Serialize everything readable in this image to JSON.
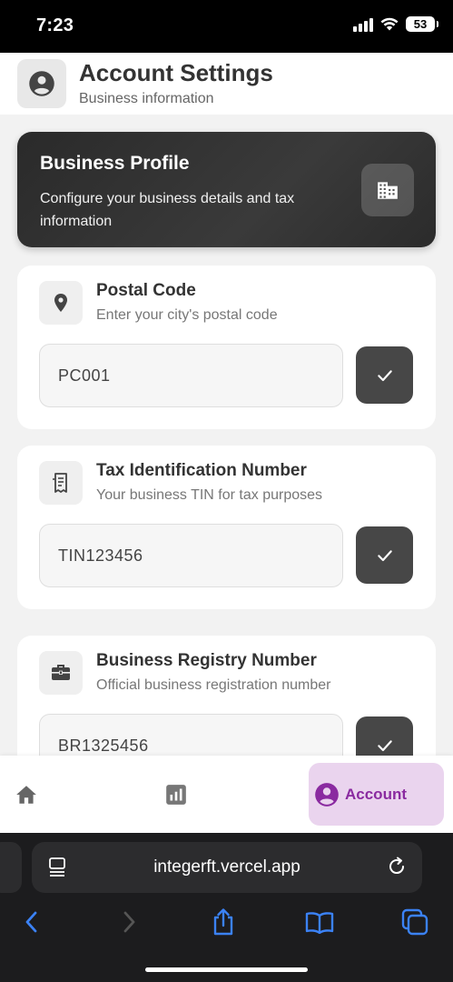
{
  "status_bar": {
    "time": "7:23",
    "battery": "53"
  },
  "header": {
    "title": "Account Settings",
    "subtitle": "Business information",
    "icon": "account-circle-icon"
  },
  "hero": {
    "title": "Business Profile",
    "description": "Configure your business details and tax information",
    "icon": "building-icon"
  },
  "fields": [
    {
      "title": "Postal Code",
      "subtitle": "Enter your city's postal code",
      "value": "PC001",
      "icon": "location-pin-icon"
    },
    {
      "title": "Tax Identification Number",
      "subtitle": "Your business TIN for tax purposes",
      "value": "TIN123456",
      "icon": "receipt-icon"
    },
    {
      "title": "Business Registry Number",
      "subtitle": "Official business registration number",
      "value": "BR1325456",
      "icon": "briefcase-icon"
    }
  ],
  "bottom_nav": {
    "items": [
      {
        "icon": "home-icon"
      },
      {
        "icon": "analytics-icon"
      },
      {
        "label": "Account",
        "icon": "account-circle-icon",
        "active": true
      }
    ]
  },
  "browser": {
    "url": "integerft.vercel.app"
  },
  "colors": {
    "accent": "#8a2aa0",
    "accent_bg": "#ead4ee",
    "dark": "#2a2a2a",
    "button": "#474747",
    "browser_blue": "#3b82f6"
  }
}
